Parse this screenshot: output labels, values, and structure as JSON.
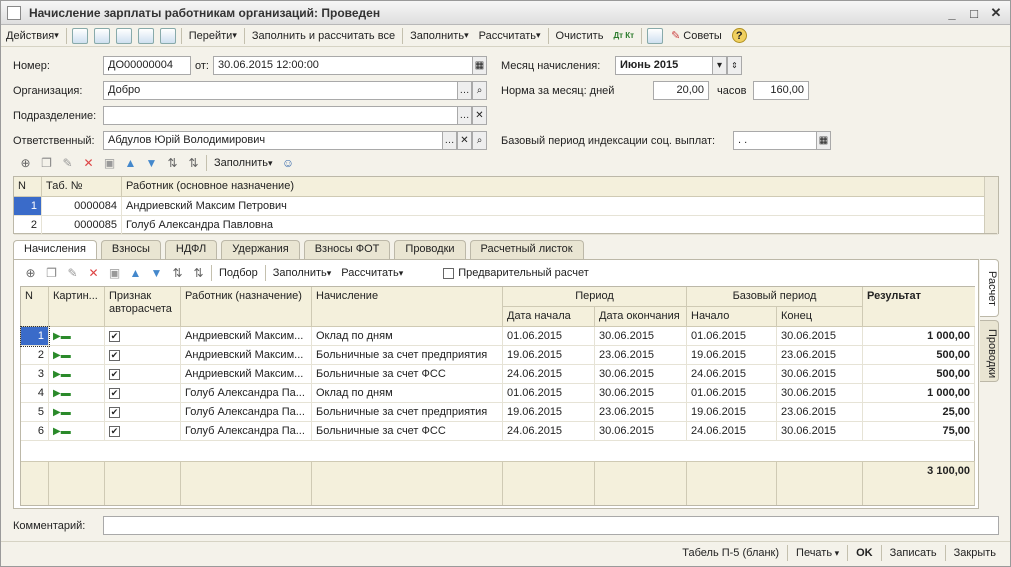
{
  "window": {
    "title": "Начисление зарплаты работникам организаций: Проведен"
  },
  "toolbar": {
    "actions": "Действия",
    "goto": "Перейти",
    "fill_calc_all": "Заполнить и рассчитать все",
    "fill": "Заполнить",
    "calc": "Рассчитать",
    "clear": "Очистить",
    "dt_kt": "Дт Кт",
    "tips": "Советы",
    "help": "?"
  },
  "header": {
    "number_label": "Номер:",
    "number": "ДО00000004",
    "date_label": "от:",
    "date": "30.06.2015 12:00:00",
    "month_label": "Месяц начисления:",
    "month": "Июнь 2015",
    "org_label": "Организация:",
    "org": "Добро",
    "norm_label": "Норма за месяц: дней",
    "norm_days": "20,00",
    "hours_label": "часов",
    "norm_hours": "160,00",
    "dept_label": "Подразделение:",
    "dept": "",
    "resp_label": "Ответственный:",
    "resp": "Абдулов Юрій Володимирович",
    "base_label": "Базовый период индексации соц. выплат:",
    "base_period": ". ."
  },
  "emp_toolbar": {
    "fill": "Заполнить"
  },
  "employees": {
    "columns": [
      "N",
      "Таб. №",
      "Работник (основное назначение)"
    ],
    "rows": [
      {
        "n": "1",
        "tab": "0000084",
        "name": "Андриевский Максим Петрович"
      },
      {
        "n": "2",
        "tab": "0000085",
        "name": "Голуб Александра Павловна"
      }
    ]
  },
  "tabs": [
    "Начисления",
    "Взносы",
    "НДФЛ",
    "Удержания",
    "Взносы ФОТ",
    "Проводки",
    "Расчетный листок"
  ],
  "side_tabs": [
    "Расчет",
    "Проводки"
  ],
  "accr_toolbar": {
    "pick": "Подбор",
    "fill": "Заполнить",
    "calc": "Рассчитать",
    "prelim": "Предварительный расчет"
  },
  "accruals": {
    "headers": {
      "n": "N",
      "pic": "Картин...",
      "auto": "Признак авторасчета",
      "emp": "Работник (назначение)",
      "accr": "Начисление",
      "period": "Период",
      "start": "Дата начала",
      "end": "Дата окончания",
      "base": "Базовый период",
      "bstart": "Начало",
      "bend": "Конец",
      "result": "Результат"
    },
    "rows": [
      {
        "n": "1",
        "emp": "Андриевский Максим...",
        "accr": "Оклад по дням",
        "start": "01.06.2015",
        "end": "30.06.2015",
        "bstart": "01.06.2015",
        "bend": "30.06.2015",
        "result": "1 000,00"
      },
      {
        "n": "2",
        "emp": "Андриевский Максим...",
        "accr": "Больничные за счет предприятия",
        "start": "19.06.2015",
        "end": "23.06.2015",
        "bstart": "19.06.2015",
        "bend": "23.06.2015",
        "result": "500,00"
      },
      {
        "n": "3",
        "emp": "Андриевский Максим...",
        "accr": "Больничные за счет ФСС",
        "start": "24.06.2015",
        "end": "30.06.2015",
        "bstart": "24.06.2015",
        "bend": "30.06.2015",
        "result": "500,00"
      },
      {
        "n": "4",
        "emp": "Голуб Александра Па...",
        "accr": "Оклад по дням",
        "start": "01.06.2015",
        "end": "30.06.2015",
        "bstart": "01.06.2015",
        "bend": "30.06.2015",
        "result": "1 000,00"
      },
      {
        "n": "5",
        "emp": "Голуб Александра Па...",
        "accr": "Больничные за счет предприятия",
        "start": "19.06.2015",
        "end": "23.06.2015",
        "bstart": "19.06.2015",
        "bend": "23.06.2015",
        "result": "25,00"
      },
      {
        "n": "6",
        "emp": "Голуб Александра Па...",
        "accr": "Больничные за счет ФСС",
        "start": "24.06.2015",
        "end": "30.06.2015",
        "bstart": "24.06.2015",
        "bend": "30.06.2015",
        "result": "75,00"
      }
    ],
    "total": "3 100,00"
  },
  "comment_label": "Комментарий:",
  "bottom": {
    "tabel": "Табель П-5 (бланк)",
    "print": "Печать",
    "ok": "OK",
    "save": "Записать",
    "close": "Закрыть"
  }
}
